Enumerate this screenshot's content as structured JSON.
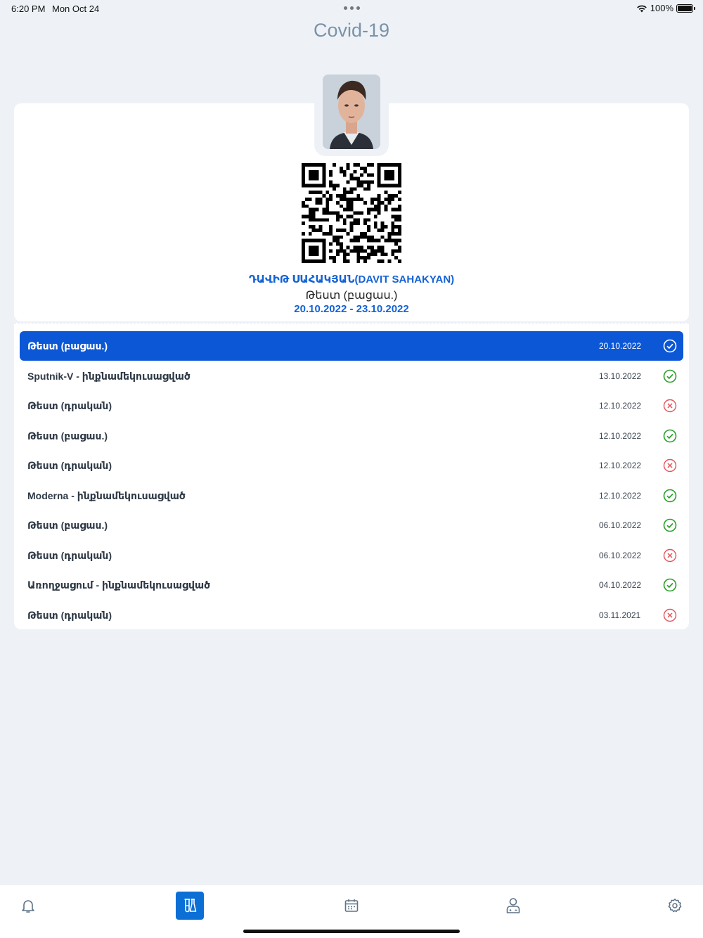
{
  "status": {
    "time": "6:20 PM",
    "date": "Mon Oct 24",
    "battery": "100%"
  },
  "page": {
    "title": "Covid-19"
  },
  "holder": {
    "name": "ԴԱՎԻԹ ՍԱՀԱԿՅԱՆ(DAVIT SAHAKYAN)",
    "type": "Թեստ (բացաս.)",
    "range": "20.10.2022 - 23.10.2022"
  },
  "records": [
    {
      "label": "Թեստ (բացաս.)",
      "date": "20.10.2022",
      "status": "ok",
      "active": true
    },
    {
      "label": "Sputnik-V - ինքնամեկուսացված",
      "date": "13.10.2022",
      "status": "ok"
    },
    {
      "label": "Թեստ (դրական)",
      "date": "12.10.2022",
      "status": "fail"
    },
    {
      "label": "Թեստ (բացաս.)",
      "date": "12.10.2022",
      "status": "ok"
    },
    {
      "label": "Թեստ (դրական)",
      "date": "12.10.2022",
      "status": "fail"
    },
    {
      "label": "Moderna - ինքնամեկուսացված",
      "date": "12.10.2022",
      "status": "ok"
    },
    {
      "label": "Թեստ (բացաս.)",
      "date": "06.10.2022",
      "status": "ok"
    },
    {
      "label": "Թեստ (դրական)",
      "date": "06.10.2022",
      "status": "fail"
    },
    {
      "label": "Առողջացում - ինքնամեկուսացված",
      "date": "04.10.2022",
      "status": "ok"
    },
    {
      "label": "Թեստ (դրական)",
      "date": "03.11.2021",
      "status": "fail"
    }
  ],
  "tabs": [
    {
      "name": "tab-notifications",
      "icon": "bell-icon"
    },
    {
      "name": "tab-tests",
      "icon": "flask-icon",
      "active": true
    },
    {
      "name": "tab-calendar",
      "icon": "calendar-icon"
    },
    {
      "name": "tab-profile",
      "icon": "doctor-icon"
    },
    {
      "name": "tab-settings",
      "icon": "gear-icon"
    }
  ],
  "colors": {
    "accent": "#0b57d6",
    "ok": "#2aa02a",
    "fail": "#e0555a",
    "title": "#7b92a8"
  }
}
